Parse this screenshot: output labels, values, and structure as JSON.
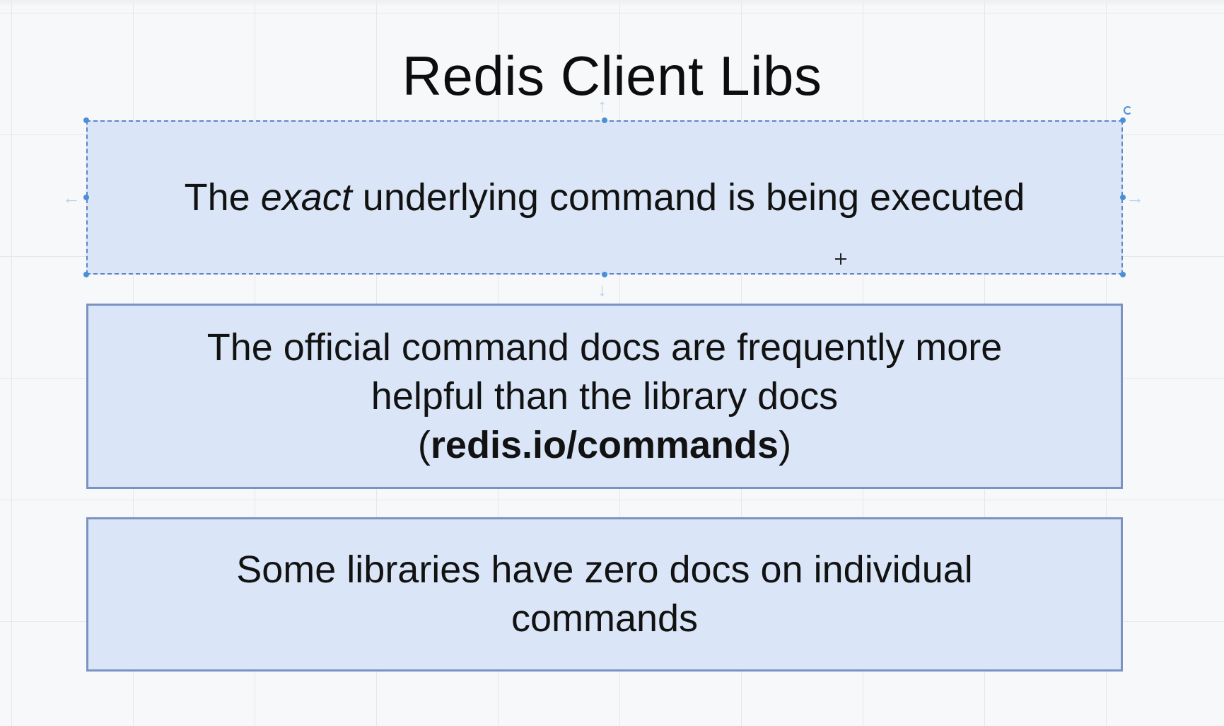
{
  "slide": {
    "title": "Redis Client Libs",
    "boxes": [
      {
        "text_before": "The ",
        "text_italic": "exact",
        "text_after": " underlying command is being executed",
        "selected": true
      },
      {
        "line1": "The official command docs are frequently more",
        "line2": "helpful than the library docs",
        "paren_open": "(",
        "bold_link": "redis.io/commands",
        "paren_close": ")"
      },
      {
        "line1": "Some libraries have zero docs on individual",
        "line2": "commands"
      }
    ]
  },
  "colors": {
    "box_fill": "#dae6f7",
    "box_border": "#7b93c2",
    "selection_handle": "#4a8fd8",
    "background": "#f7f8fa"
  },
  "icons": [
    "rotate-handle-icon",
    "move-crosshair-cursor-icon",
    "resize-arrow-icon"
  ]
}
